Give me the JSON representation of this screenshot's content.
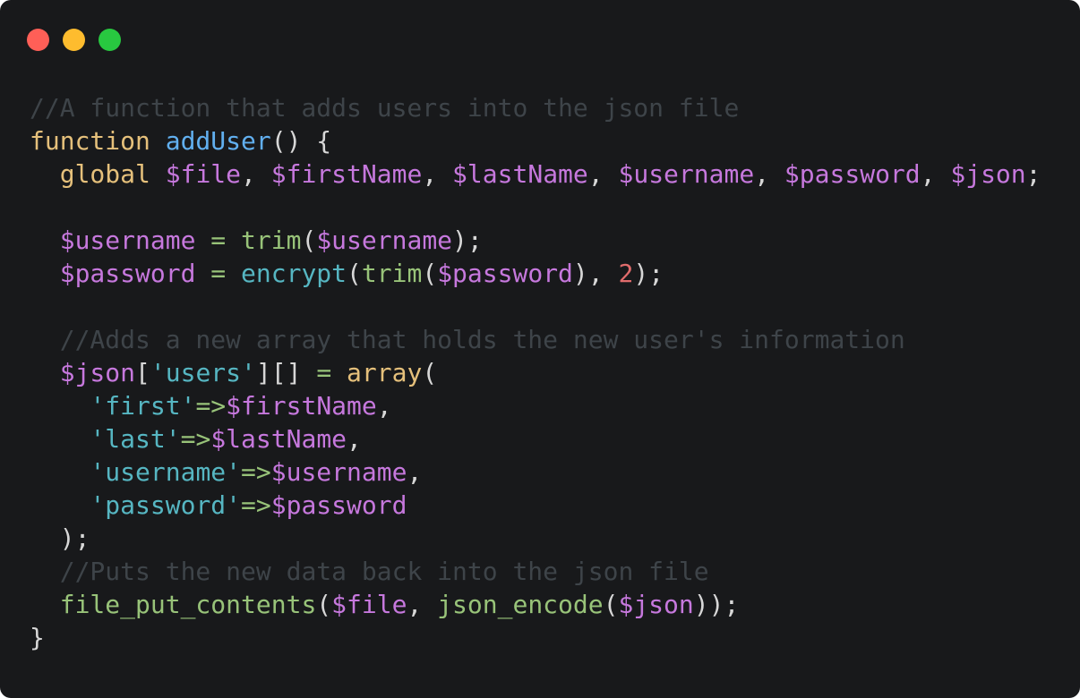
{
  "window": {
    "controls": {
      "close_color": "#ff5f57",
      "minimize_color": "#febc2e",
      "maximize_color": "#28c840"
    },
    "background": "#18191b"
  },
  "colors": {
    "comment": "#3e4449",
    "keyword": "#e5c07b",
    "function_name": "#61afef",
    "builtin": "#98c379",
    "call": "#56b6c2",
    "variable": "#c678dd",
    "punctuation": "#d7d7d7",
    "number": "#e06c6c",
    "string": "#56b6c2",
    "operator": "#98c379"
  },
  "code": {
    "lines": [
      [
        {
          "t": "comment",
          "v": "//A function that adds users into the json file"
        }
      ],
      [
        {
          "t": "keyword",
          "v": "function"
        },
        {
          "t": "punct",
          "v": " "
        },
        {
          "t": "funcname",
          "v": "addUser"
        },
        {
          "t": "punct",
          "v": "() {"
        }
      ],
      [
        {
          "t": "punct",
          "v": "  "
        },
        {
          "t": "keyword",
          "v": "global"
        },
        {
          "t": "punct",
          "v": " "
        },
        {
          "t": "var",
          "v": "$file"
        },
        {
          "t": "punct",
          "v": ", "
        },
        {
          "t": "var",
          "v": "$firstName"
        },
        {
          "t": "punct",
          "v": ", "
        },
        {
          "t": "var",
          "v": "$lastName"
        },
        {
          "t": "punct",
          "v": ", "
        },
        {
          "t": "var",
          "v": "$username"
        },
        {
          "t": "punct",
          "v": ", "
        },
        {
          "t": "var",
          "v": "$password"
        },
        {
          "t": "punct",
          "v": ", "
        },
        {
          "t": "var",
          "v": "$json"
        },
        {
          "t": "punct",
          "v": ";"
        }
      ],
      [],
      [
        {
          "t": "punct",
          "v": "  "
        },
        {
          "t": "var",
          "v": "$username"
        },
        {
          "t": "punct",
          "v": " "
        },
        {
          "t": "op",
          "v": "="
        },
        {
          "t": "punct",
          "v": " "
        },
        {
          "t": "builtin",
          "v": "trim"
        },
        {
          "t": "punct",
          "v": "("
        },
        {
          "t": "var",
          "v": "$username"
        },
        {
          "t": "punct",
          "v": ");"
        }
      ],
      [
        {
          "t": "punct",
          "v": "  "
        },
        {
          "t": "var",
          "v": "$password"
        },
        {
          "t": "punct",
          "v": " "
        },
        {
          "t": "op",
          "v": "="
        },
        {
          "t": "punct",
          "v": " "
        },
        {
          "t": "call",
          "v": "encrypt"
        },
        {
          "t": "punct",
          "v": "("
        },
        {
          "t": "builtin",
          "v": "trim"
        },
        {
          "t": "punct",
          "v": "("
        },
        {
          "t": "var",
          "v": "$password"
        },
        {
          "t": "punct",
          "v": "), "
        },
        {
          "t": "num",
          "v": "2"
        },
        {
          "t": "punct",
          "v": ");"
        }
      ],
      [],
      [
        {
          "t": "punct",
          "v": "  "
        },
        {
          "t": "comment",
          "v": "//Adds a new array that holds the new user's information"
        }
      ],
      [
        {
          "t": "punct",
          "v": "  "
        },
        {
          "t": "var",
          "v": "$json"
        },
        {
          "t": "punct",
          "v": "["
        },
        {
          "t": "str",
          "v": "'users'"
        },
        {
          "t": "punct",
          "v": "][] "
        },
        {
          "t": "op",
          "v": "="
        },
        {
          "t": "punct",
          "v": " "
        },
        {
          "t": "keyword",
          "v": "array"
        },
        {
          "t": "punct",
          "v": "("
        }
      ],
      [
        {
          "t": "punct",
          "v": "    "
        },
        {
          "t": "str",
          "v": "'first'"
        },
        {
          "t": "op",
          "v": "=>"
        },
        {
          "t": "var",
          "v": "$firstName"
        },
        {
          "t": "punct",
          "v": ","
        }
      ],
      [
        {
          "t": "punct",
          "v": "    "
        },
        {
          "t": "str",
          "v": "'last'"
        },
        {
          "t": "op",
          "v": "=>"
        },
        {
          "t": "var",
          "v": "$lastName"
        },
        {
          "t": "punct",
          "v": ","
        }
      ],
      [
        {
          "t": "punct",
          "v": "    "
        },
        {
          "t": "str",
          "v": "'username'"
        },
        {
          "t": "op",
          "v": "=>"
        },
        {
          "t": "var",
          "v": "$username"
        },
        {
          "t": "punct",
          "v": ","
        }
      ],
      [
        {
          "t": "punct",
          "v": "    "
        },
        {
          "t": "str",
          "v": "'password'"
        },
        {
          "t": "op",
          "v": "=>"
        },
        {
          "t": "var",
          "v": "$password"
        }
      ],
      [
        {
          "t": "punct",
          "v": "  );"
        }
      ],
      [
        {
          "t": "punct",
          "v": "  "
        },
        {
          "t": "comment",
          "v": "//Puts the new data back into the json file"
        }
      ],
      [
        {
          "t": "punct",
          "v": "  "
        },
        {
          "t": "builtin",
          "v": "file_put_contents"
        },
        {
          "t": "punct",
          "v": "("
        },
        {
          "t": "var",
          "v": "$file"
        },
        {
          "t": "punct",
          "v": ", "
        },
        {
          "t": "builtin",
          "v": "json_encode"
        },
        {
          "t": "punct",
          "v": "("
        },
        {
          "t": "var",
          "v": "$json"
        },
        {
          "t": "punct",
          "v": "));"
        }
      ],
      [
        {
          "t": "punct",
          "v": "}"
        }
      ]
    ]
  }
}
